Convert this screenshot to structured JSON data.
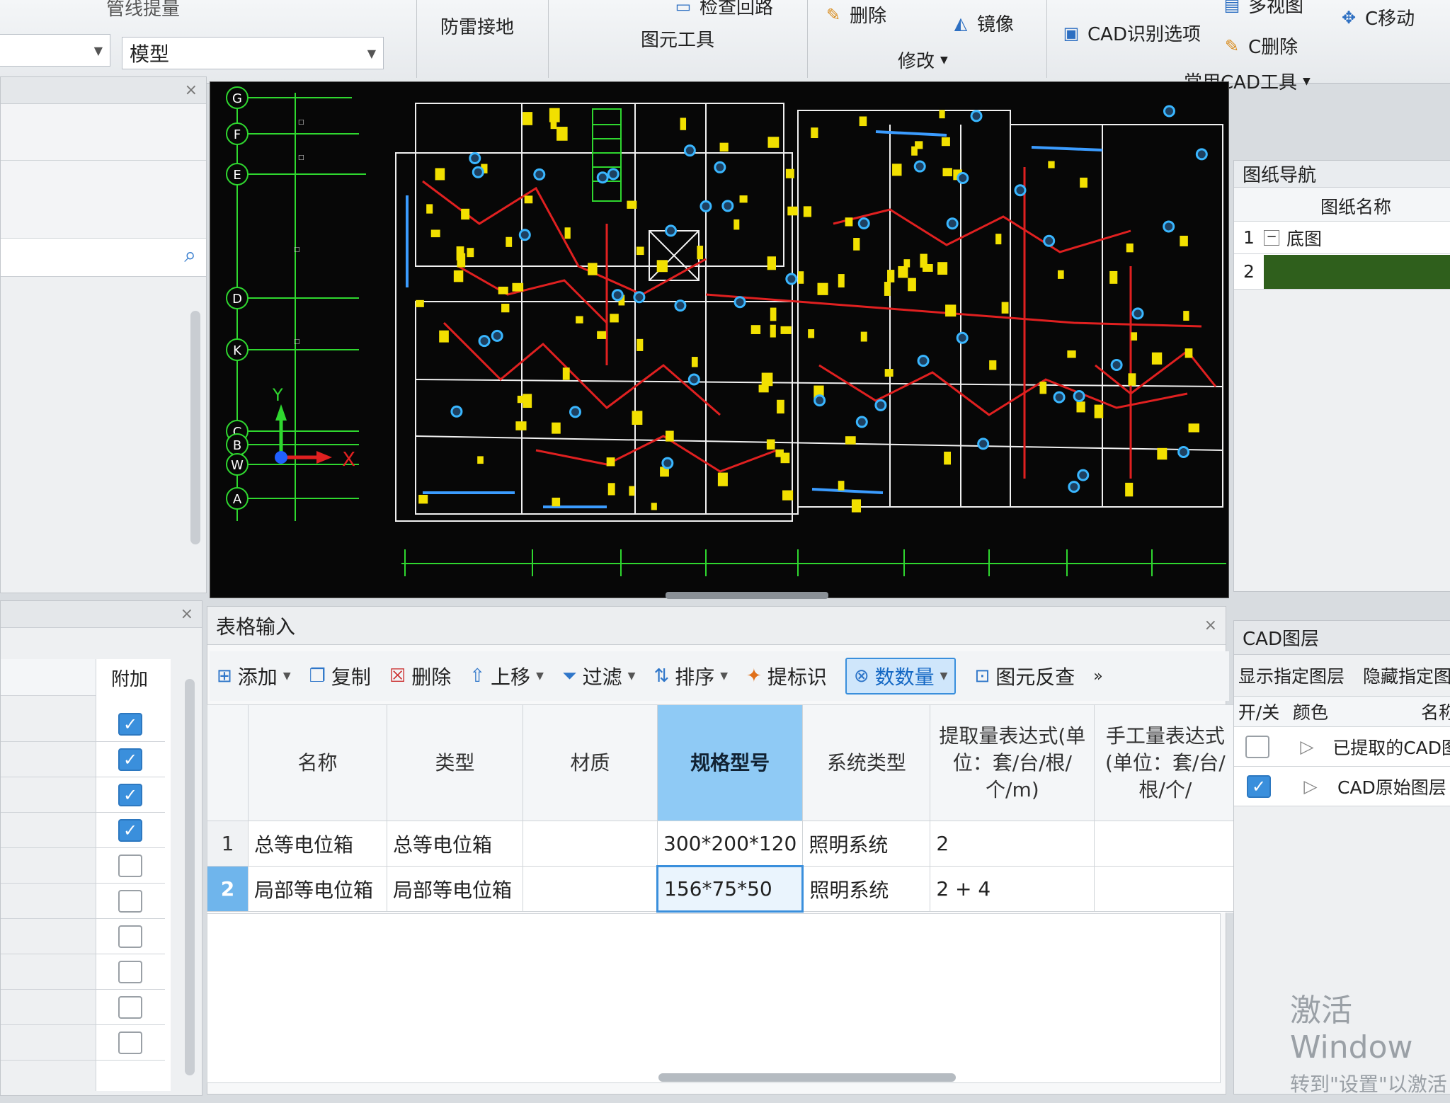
{
  "ribbon": {
    "top_left_label": "管线提量",
    "grounding": "防雷接地",
    "check_circuit": "检查回路",
    "element_tools": "图元工具",
    "delete": "删除",
    "mirror": "镜像",
    "modify": "修改",
    "cad_options": "CAD识别选项",
    "c_delete": "C删除",
    "multi_view": "多视图",
    "c_move": "C移动",
    "common_cad_tools": "常用CAD工具",
    "model_combo": "模型"
  },
  "drawing_nav": {
    "title": "图纸导航",
    "col_name": "图纸名称",
    "rows": [
      {
        "num": "1",
        "name": "底图",
        "toggle": "−"
      },
      {
        "num": "2",
        "name": ""
      }
    ]
  },
  "table_input": {
    "title": "表格输入",
    "toolbar": {
      "add": "添加",
      "copy": "复制",
      "delete": "删除",
      "move_up": "上移",
      "filter": "过滤",
      "sort": "排序",
      "mark": "提标识",
      "count": "数数量",
      "reverse": "图元反查",
      "more": "»"
    },
    "columns": [
      "名称",
      "类型",
      "材质",
      "规格型号",
      "系统类型",
      "提取量表达式(单位：套/台/根/个/m)",
      "手工量表达式(单位：套/台/根/个/"
    ],
    "rows": [
      {
        "num": "1",
        "name": "总等电位箱",
        "type": "总等电位箱",
        "material": "",
        "spec": "300*200*120",
        "system": "照明系统",
        "extract": "2",
        "manual": ""
      },
      {
        "num": "2",
        "name": "局部等电位箱",
        "type": "局部等电位箱",
        "material": "",
        "spec": "156*75*50",
        "system": "照明系统",
        "extract": "2 + 4",
        "manual": ""
      }
    ]
  },
  "left_attr": {
    "col_extra": "附加",
    "checks": [
      true,
      true,
      true,
      true,
      false,
      false,
      false,
      false,
      false,
      false
    ]
  },
  "cad_layers": {
    "title": "CAD图层",
    "show_layer": "显示指定图层",
    "hide_layer": "隐藏指定图层",
    "col_onoff": "开/关",
    "col_color": "颜色",
    "col_name": "名称",
    "rows": [
      {
        "checked": false,
        "name": "已提取的CAD图"
      },
      {
        "checked": true,
        "name": "CAD原始图层"
      }
    ]
  },
  "axis_labels": [
    "G",
    "F",
    "E",
    "D",
    "K",
    "C",
    "B",
    "W",
    "A"
  ],
  "watermark": {
    "line1": "激活 Window",
    "line2": "转到\"设置\"以激活"
  },
  "colors": {
    "accent": "#3a8fdc",
    "cad_bg": "#070707",
    "wire": "#e02020",
    "device": "#f2e000"
  }
}
